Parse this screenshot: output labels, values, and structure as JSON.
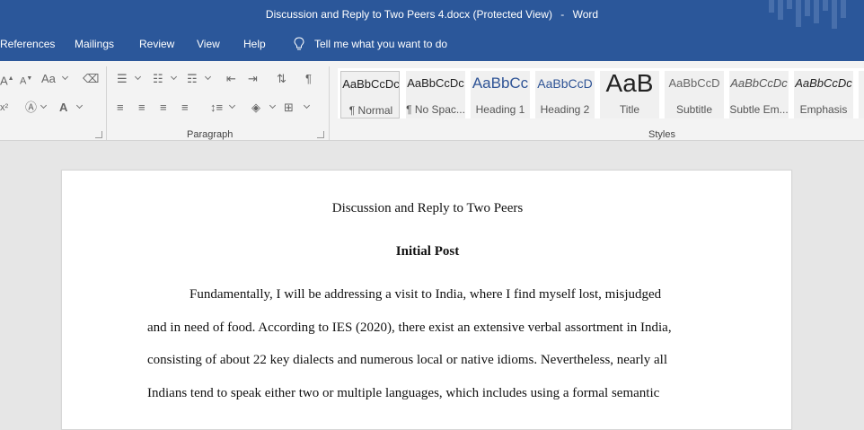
{
  "window": {
    "doc_title": "Discussion and Reply to Two Peers 4.docx (Protected View)",
    "separator": "-",
    "app_name": "Word"
  },
  "menu": {
    "tabs": [
      "References",
      "Mailings",
      "Review",
      "View",
      "Help"
    ],
    "tell_me": "Tell me what you want to do"
  },
  "ribbon": {
    "paragraph_label": "Paragraph",
    "styles_label": "Styles",
    "font_size_glyphs": {
      "grow": "A",
      "shrink": "A",
      "change_case": "Aa"
    },
    "styles": [
      {
        "sample": "AaBbCcDc",
        "name": "¶ Normal"
      },
      {
        "sample": "AaBbCcDc",
        "name": "¶ No Spac..."
      },
      {
        "sample": "AaBbCc",
        "name": "Heading 1"
      },
      {
        "sample": "AaBbCcD",
        "name": "Heading 2"
      },
      {
        "sample": "AaB",
        "name": "Title"
      },
      {
        "sample": "AaBbCcD",
        "name": "Subtitle"
      },
      {
        "sample": "AaBbCcDc",
        "name": "Subtle Em..."
      },
      {
        "sample": "AaBbCcDc",
        "name": "Emphasis"
      }
    ]
  },
  "document": {
    "title": "Discussion and Reply to Two Peers",
    "heading": "Initial Post",
    "lines": [
      "Fundamentally, I will be addressing a visit to India, where I find myself lost, misjudged",
      "and in need of food. According to IES (2020), there exist an extensive verbal assortment in India,",
      "consisting of about 22 key dialects and numerous local or native idioms. Nevertheless, nearly all",
      "Indians tend to speak either two or multiple languages, which includes using a formal semantic"
    ]
  },
  "colors": {
    "title_bar": "#2b579a",
    "ribbon_bg": "#f3f3f3",
    "doc_bg": "#e6e6e6",
    "page_bg": "#ffffff"
  }
}
